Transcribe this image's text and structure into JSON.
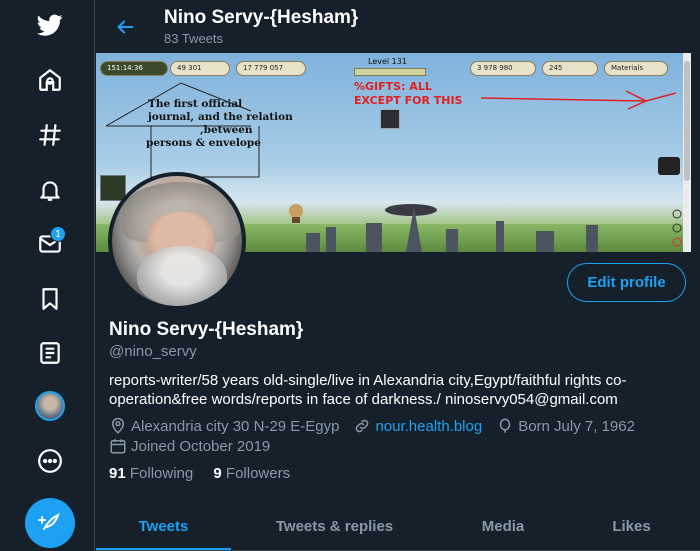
{
  "sidebar": {
    "items": [
      {
        "name": "twitter-logo-icon"
      },
      {
        "name": "home-icon"
      },
      {
        "name": "explore-icon"
      },
      {
        "name": "notifications-icon"
      },
      {
        "name": "messages-icon",
        "badge": "1"
      },
      {
        "name": "bookmarks-icon"
      },
      {
        "name": "lists-icon"
      },
      {
        "name": "profile-avatar-icon"
      },
      {
        "name": "more-icon"
      }
    ],
    "compose_icon": "compose-tweet-icon"
  },
  "header": {
    "title": "Nino Servy-{Hesham}",
    "subtitle": "83 Tweets"
  },
  "banner": {
    "level": "Level 131",
    "hud_values": [
      "151:14:36",
      "49 301",
      "17 779 057",
      "3 978 980",
      "245",
      "Materials"
    ],
    "gifts_text_1": "%GIFTS: ALL",
    "gifts_text_2": "EXCEPT FOR THIS",
    "note_1": "The first official",
    "note_2": "journal,",
    "note_3": "and the relation",
    "note_4": ",between",
    "note_5": "persons & envelope"
  },
  "profile": {
    "edit_label": "Edit profile",
    "name": "Nino Servy-{Hesham}",
    "handle": "@nino_servy",
    "bio": "reports-writer/58 years old-single/live in Alexandria city,Egypt/faithful rights co-operation&free words/reports in face of darkness./ ninoservy054@gmail.com",
    "location": "Alexandria city 30 N-29 E-Egyp",
    "website": "nour.health.blog",
    "birthday": "Born July 7, 1962",
    "joined": "Joined October 2019",
    "following_count": "91",
    "following_label": "Following",
    "followers_count": "9",
    "followers_label": "Followers"
  },
  "tabs": [
    {
      "label": "Tweets",
      "active": true
    },
    {
      "label": "Tweets & replies",
      "active": false
    },
    {
      "label": "Media",
      "active": false
    },
    {
      "label": "Likes",
      "active": false
    }
  ],
  "colors": {
    "accent": "#1da1f2",
    "background": "#15202b",
    "muted": "#8899a6",
    "border": "#38444d"
  }
}
